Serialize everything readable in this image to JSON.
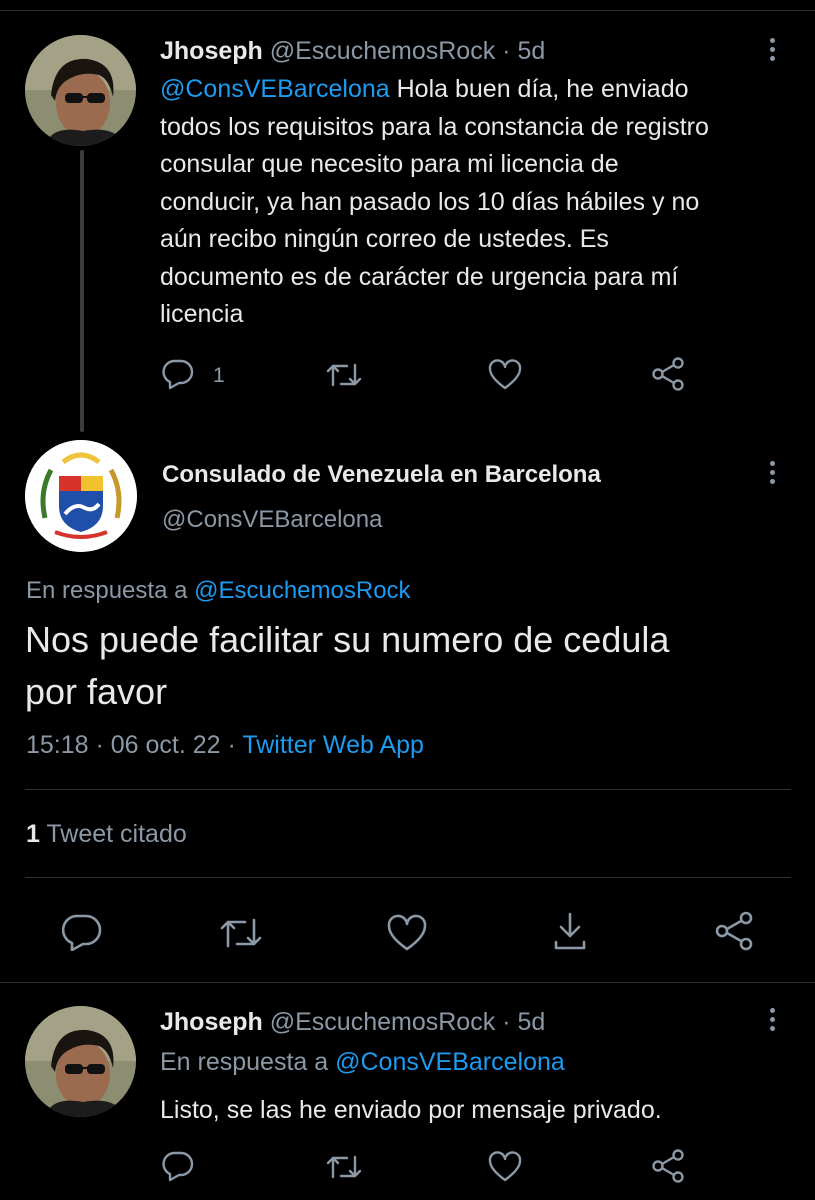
{
  "tweet1": {
    "name": "Jhoseph",
    "handle": "@EscuchemosRock",
    "dot": "·",
    "time": "5d",
    "mention": "@ConsVEBarcelona",
    "lines": [
      "Hola buen día, he enviado",
      "todos los requisitos para la constancia de registro",
      "consular que necesito para mi licencia de",
      "conducir, ya han pasado los 10 días hábiles y no",
      "aún recibo ningún correo de ustedes. Es",
      "documento es de carácter de urgencia para mí",
      "licencia"
    ],
    "reply_count": "1"
  },
  "main": {
    "name": "Consulado de Venezuela en Barcelona",
    "handle": "@ConsVEBarcelona",
    "reply_prefix": "En respuesta a",
    "reply_to": "@EscuchemosRock",
    "text_line1": "Nos puede facilitar su numero de cedula",
    "text_line2": "por favor",
    "timestamp": "15:18 · 06 oct. 22 ·",
    "source": "Twitter Web App",
    "quote_count": "1",
    "quote_label": "Tweet citado"
  },
  "tweet3": {
    "name": "Jhoseph",
    "handle": "@EscuchemosRock",
    "dot": "·",
    "time": "5d",
    "reply_prefix": "En respuesta a",
    "reply_to": "@ConsVEBarcelona",
    "text": "Listo, se las he enviado por mensaje privado."
  },
  "colors": {
    "background": "#000000",
    "text": "#e7e9ea",
    "muted": "#8b98a5",
    "link": "#1d9bf0",
    "divider": "#2f3336"
  },
  "icons": [
    "reply-icon",
    "retweet-icon",
    "like-icon",
    "share-icon",
    "bookmark-download-icon",
    "more-icon"
  ]
}
